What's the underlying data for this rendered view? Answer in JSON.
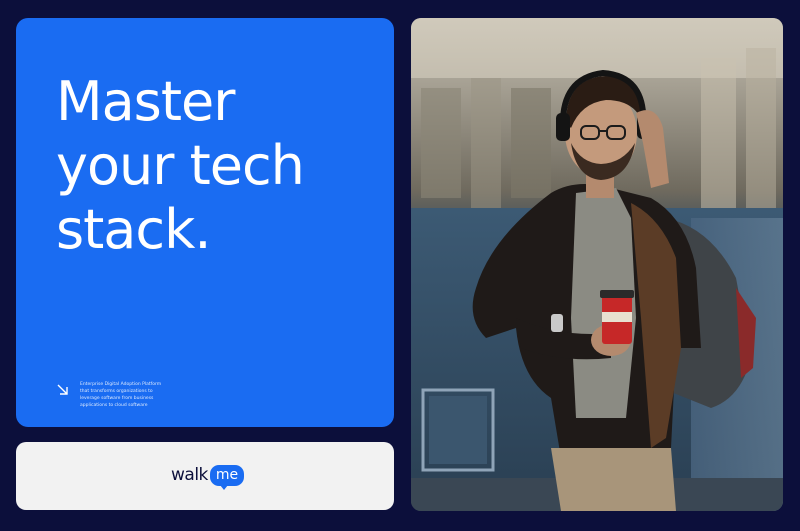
{
  "headline": {
    "line1": "Master",
    "line2": "your tech",
    "line3": "stack."
  },
  "body_text": [
    "Enterprise Digital Adoption Platform",
    "that transforms organizations to",
    "leverage software from business",
    "applications to cloud software"
  ],
  "brand": {
    "logo_part1": "walk",
    "logo_part2": "me"
  },
  "icons": {
    "arrow": "arrow-down-right-icon"
  },
  "colors": {
    "background": "#0c0f3b",
    "accent_blue": "#1a6cf2",
    "logo_card": "#f2f2f2"
  }
}
